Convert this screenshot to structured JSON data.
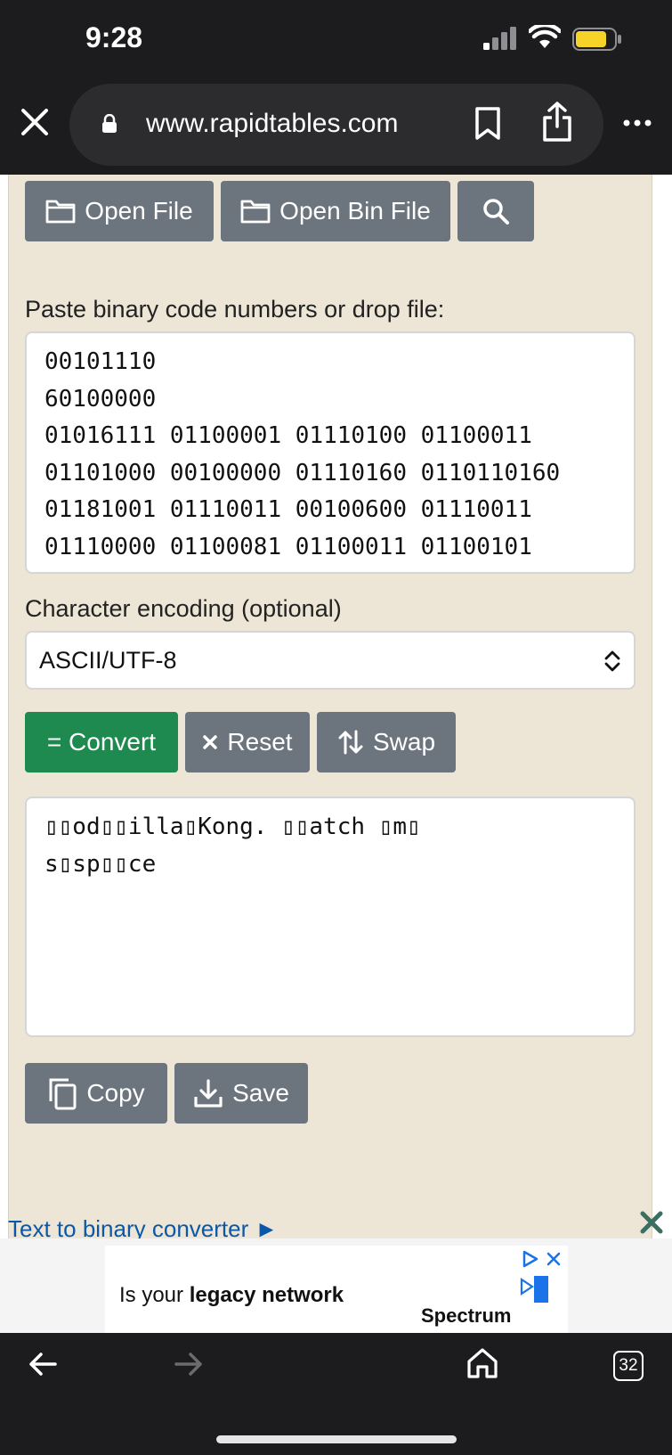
{
  "status": {
    "time": "9:28"
  },
  "browser": {
    "url": "www.rapidtables.com",
    "tabs_count": "32"
  },
  "toolbar_top": {
    "open_file": "Open File",
    "open_bin_file": "Open Bin File"
  },
  "input": {
    "label": "Paste binary code numbers or drop file:",
    "value": "00101110\n60100000\n01016111 01100001 01110100 01100011\n01101000 00100000 01110160 0110110160\n01181001 01110011 00100600 01110011\n01110000 01100081 01100011 01100101"
  },
  "encoding": {
    "label": "Character encoding (optional)",
    "selected": "ASCII/UTF-8"
  },
  "actions": {
    "convert": "= Convert",
    "reset": "Reset",
    "swap": "Swap"
  },
  "output": {
    "value": "▯▯od▯▯illa▯Kong. ▯▯atch ▯m▯\ns▯sp▯▯ce"
  },
  "output_actions": {
    "copy": "Copy",
    "save": "Save"
  },
  "related_link": "Text to binary converter ►",
  "ad": {
    "text_pre": "Is your ",
    "text_bold": "legacy network",
    "brand": "Spectrum"
  },
  "colors": {
    "panel_bg": "#ede6d6",
    "button_gray": "#6c757d",
    "convert_green": "#1e8a50",
    "link_blue": "#0b57a8"
  }
}
